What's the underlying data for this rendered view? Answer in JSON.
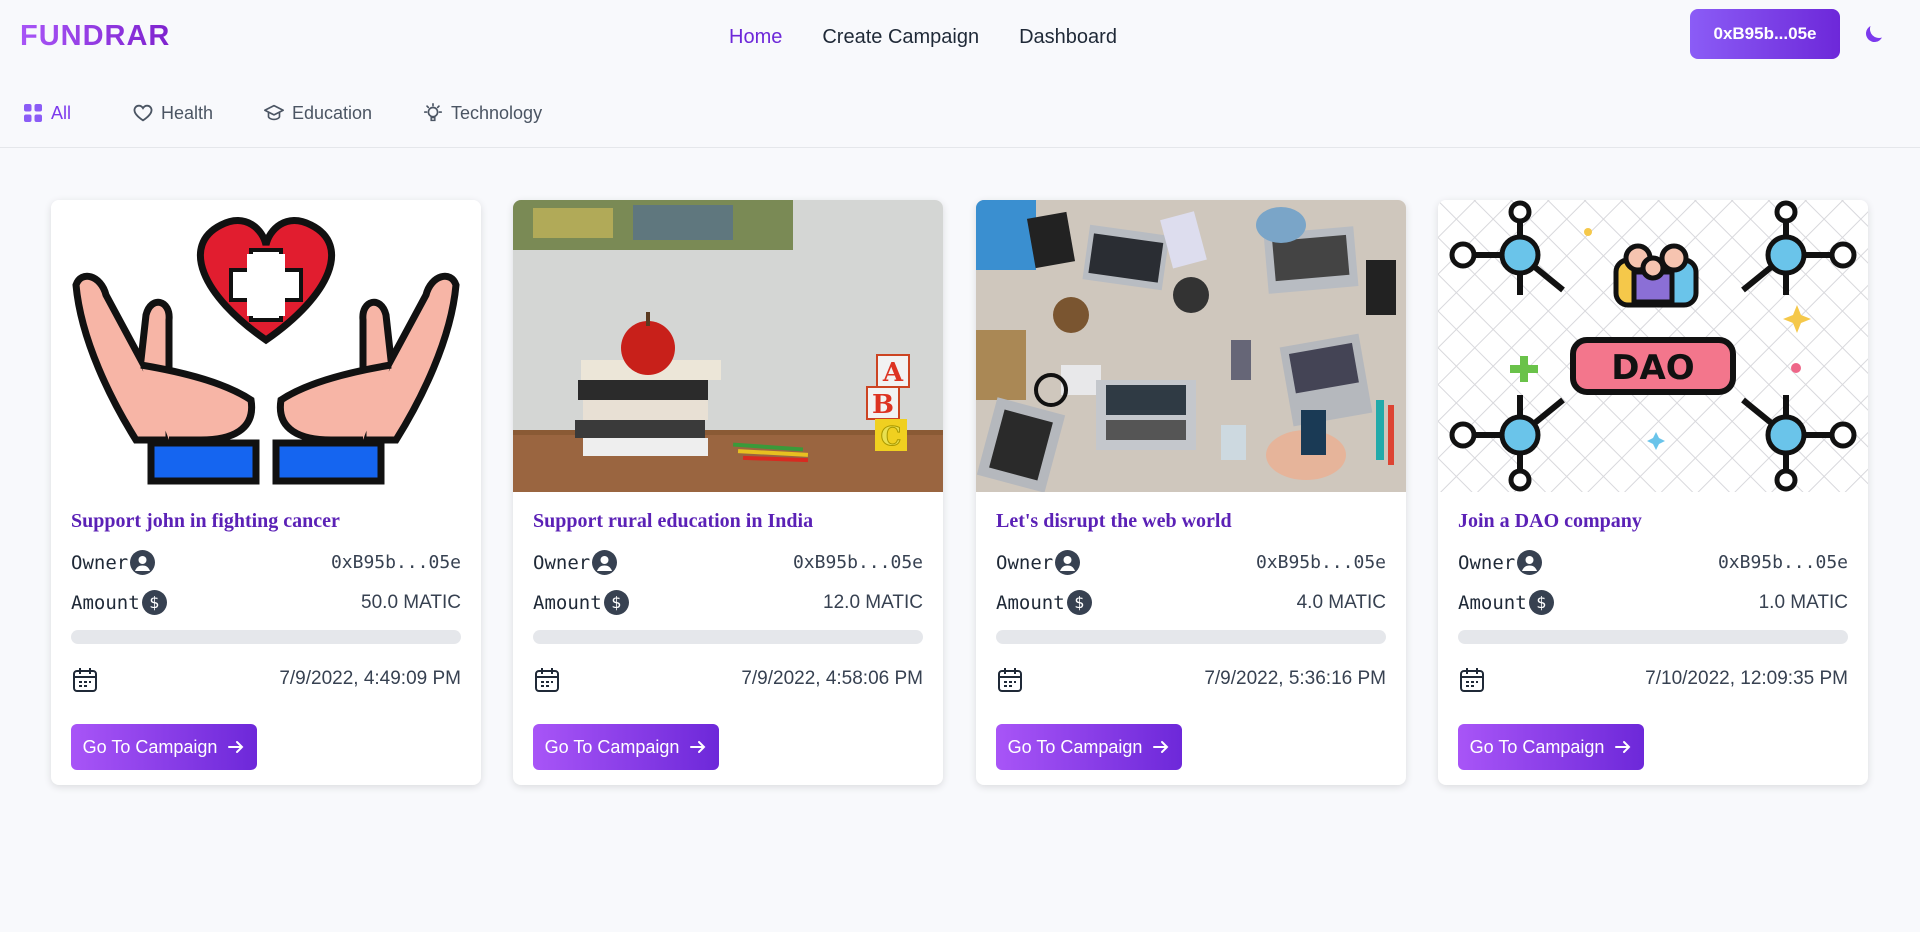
{
  "header": {
    "logo": "FUNDRAR",
    "nav": [
      {
        "label": "Home",
        "active": true
      },
      {
        "label": "Create Campaign",
        "active": false
      },
      {
        "label": "Dashboard",
        "active": false
      }
    ],
    "wallet_label": "0xB95b...05e",
    "theme_icon": "moon-icon"
  },
  "categories": [
    {
      "label": "All",
      "icon": "grid-icon",
      "active": true
    },
    {
      "label": "Health",
      "icon": "heart-icon",
      "active": false
    },
    {
      "label": "Education",
      "icon": "graduation-cap-icon",
      "active": false
    },
    {
      "label": "Technology",
      "icon": "lightbulb-icon",
      "active": false
    }
  ],
  "campaigns": [
    {
      "title": "Support john in fighting cancer",
      "owner_label": "Owner",
      "owner": "0xB95b...05e",
      "amount_label": "Amount",
      "amount": "50.0 MATIC",
      "progress": 0,
      "date": "7/9/2022, 4:49:09 PM",
      "button": "Go To Campaign",
      "image": "health-hands-heart-illustration"
    },
    {
      "title": "Support rural education in India",
      "owner_label": "Owner",
      "owner": "0xB95b...05e",
      "amount_label": "Amount",
      "amount": "12.0 MATIC",
      "progress": 0,
      "date": "7/9/2022, 4:58:06 PM",
      "button": "Go To Campaign",
      "image": "books-apple-blocks-photo"
    },
    {
      "title": "Let's disrupt the web world",
      "owner_label": "Owner",
      "owner": "0xB95b...05e",
      "amount_label": "Amount",
      "amount": "4.0 MATIC",
      "progress": 0,
      "date": "7/9/2022, 5:36:16 PM",
      "button": "Go To Campaign",
      "image": "laptops-desk-photo"
    },
    {
      "title": "Join a DAO company",
      "owner_label": "Owner",
      "owner": "0xB95b...05e",
      "amount_label": "Amount",
      "amount": "1.0 MATIC",
      "progress": 0,
      "date": "7/10/2022, 12:09:35 PM",
      "button": "Go To Campaign",
      "image": "dao-network-illustration"
    }
  ],
  "colors": {
    "accent": "#7c3aed",
    "accent_dark": "#6d28d9",
    "title": "#5b21b6"
  }
}
